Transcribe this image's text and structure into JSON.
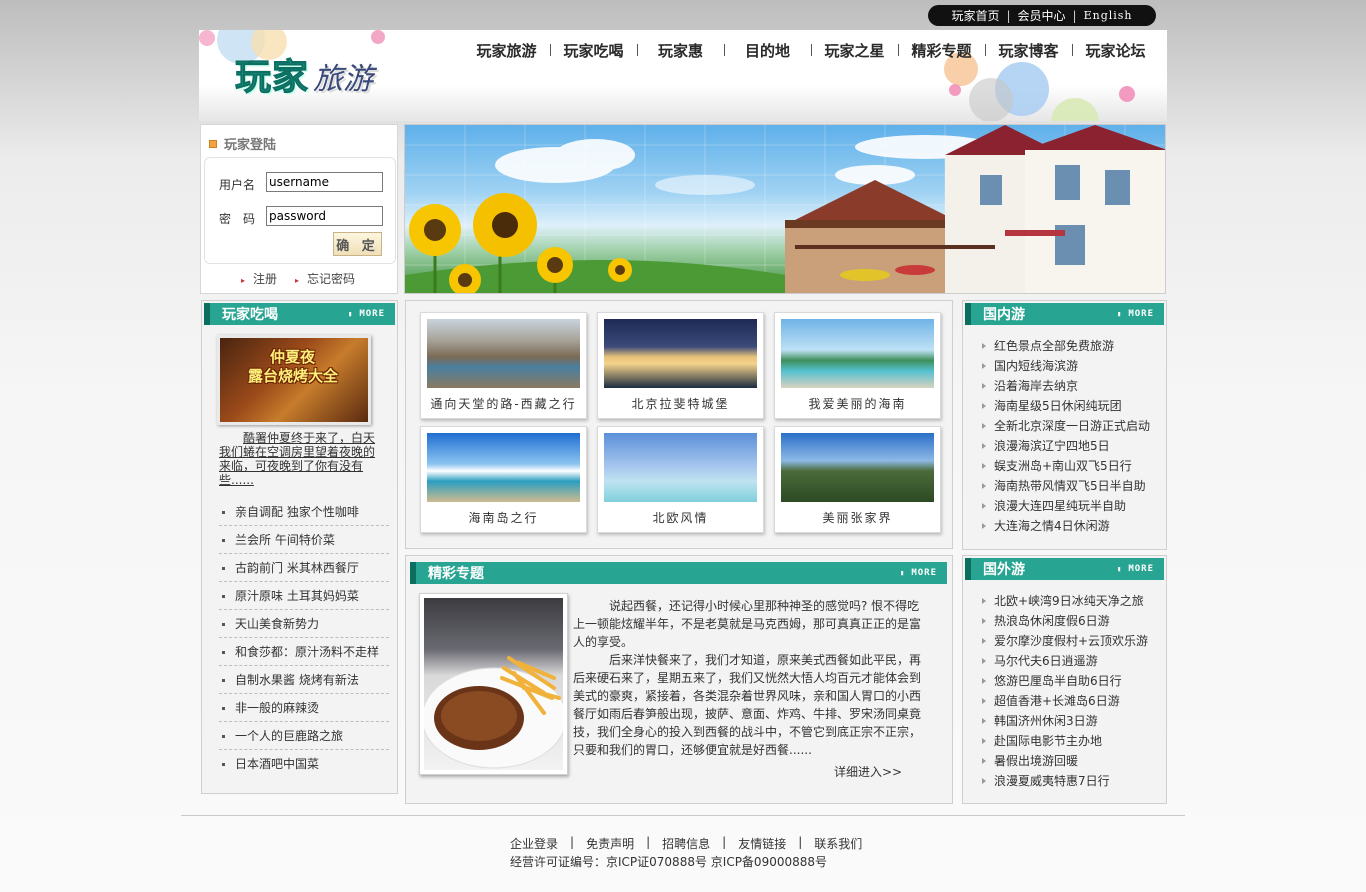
{
  "toplinks": {
    "home": "玩家首页",
    "member": "会员中心",
    "english": "English",
    "separator": "|"
  },
  "logo": {
    "part1": "玩家",
    "part2": "旅游"
  },
  "nav": [
    "玩家旅游",
    "玩家吃喝",
    "玩家惠",
    "目的地",
    "玩家之星",
    "精彩专题",
    "玩家博客",
    "玩家论坛"
  ],
  "login": {
    "title": "玩家登陆",
    "username_label": "用户名",
    "password_label": "密　码",
    "username_value": "username",
    "password_value": "password",
    "submit": "确 定",
    "register": "注册",
    "forgot": "忘记密码"
  },
  "food": {
    "title": "玩家吃喝",
    "more": "MORE",
    "banner_text": [
      "仲夏夜",
      "露台烧烤大全"
    ],
    "intro": "酷署仲夏终于来了，白天我们蜷在空调房里望着夜晚的来临，可夜晚到了你有没有些......",
    "items": [
      "亲自调配 独家个性咖啡",
      "兰会所 午间特价菜",
      "古韵前门 米其林西餐厅",
      "原汁原味 土耳其妈妈菜",
      "天山美食新势力",
      "和食莎都：原汁汤料不走样",
      "自制水果酱 烧烤有新法",
      "非一般的麻辣烫",
      "一个人的巨鹿路之旅",
      "日本酒吧中国菜"
    ]
  },
  "photos": [
    {
      "caption": "通向天堂的路-西藏之行"
    },
    {
      "caption": "北京拉斐特城堡"
    },
    {
      "caption": "我爱美丽的海南"
    },
    {
      "caption": "海南岛之行"
    },
    {
      "caption": "北欧风情"
    },
    {
      "caption": "美丽张家界"
    }
  ],
  "feature": {
    "title": "精彩专题",
    "more": "MORE",
    "para1": "说起西餐，还记得小时候心里那种神圣的感觉吗? 恨不得吃上一顿能炫耀半年，不是老莫就是马克西姆，那可真真正正的是富人的享受。",
    "para2": "后来洋快餐来了，我们才知道，原来美式西餐如此平民，再后来硬石来了，星期五来了，我们又恍然大悟人均百元才能体会到美式的豪爽，紧接着，各类混杂着世界风味，亲和国人胃口的小西餐厅如雨后春笋般出现，披萨、意面、炸鸡、牛排、罗宋汤同桌竟技，我们全身心的投入到西餐的战斗中，不管它到底正宗不正宗，只要和我们的胃口，还够便宜就是好西餐......",
    "readmore": "详细进入>>"
  },
  "domestic": {
    "title": "国内游",
    "more": "MORE",
    "items": [
      "红色景点全部免费旅游",
      "国内短线海滨游",
      "沿着海岸去纳京",
      "海南星级5日休闲纯玩团",
      "全新北京深度一日游正式启动",
      "浪漫海滨辽宁四地5日",
      "蜈支洲岛+南山双飞5日行",
      "海南热带风情双飞5日半自助",
      "浪漫大连四星纯玩半自助",
      "大连海之情4日休闲游"
    ]
  },
  "abroad": {
    "title": "国外游",
    "more": "MORE",
    "items": [
      "北欧+峡湾9日冰纯天净之旅",
      "热浪岛休闲度假6日游",
      "爱尔摩沙度假村+云顶欢乐游",
      "马尔代夫6日逍遥游",
      "悠游巴厘岛半自助6日行",
      "超值香港+长滩岛6日游",
      "韩国济州休闲3日游",
      "赴国际电影节主办地",
      "暑假出境游回暖",
      "浪漫夏威夷特惠7日行"
    ]
  },
  "footer": {
    "links": [
      "企业登录",
      "免责声明",
      "招聘信息",
      "友情链接",
      "联系我们"
    ],
    "separator": "|",
    "icp": "经营许可证编号：京ICP证070888号 京ICP备09000888号"
  },
  "colors": {
    "accent": "#27a492",
    "accent_dark": "#0c6e5e",
    "toplinks_bg": "#111111"
  }
}
